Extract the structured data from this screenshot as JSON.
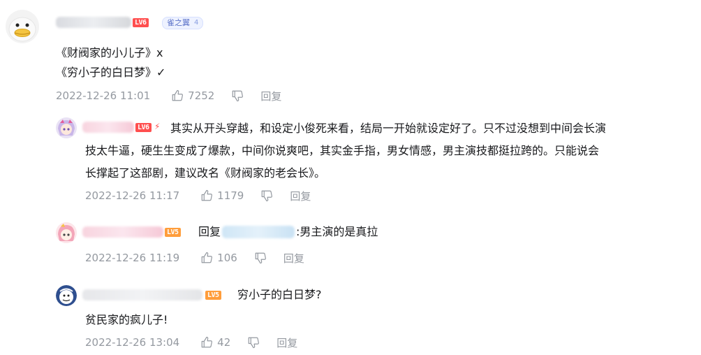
{
  "main_comment": {
    "user_level": "LV6",
    "fan_badge": {
      "label": "雀之翼",
      "level": "4"
    },
    "lines": [
      "《财阀家的小儿子》x",
      "《穷小子的白日梦》✓"
    ],
    "time": "2022-12-26 11:01",
    "likes": "7252",
    "reply_label": "回复"
  },
  "replies": [
    {
      "user_level": "LV6",
      "lines": [
        "其实从开头穿越，和设定小俊死来看，结局一开始就设定好了。只不过没想到中间会长演",
        "技太牛逼，硬生生变成了爆款，中间你说爽吧，其实金手指，男女情感，男主演技都挺拉跨的。只能说会",
        "长撑起了这部剧，建议改名《财阀家的老会长》。"
      ],
      "time": "2022-12-26 11:17",
      "likes": "1179",
      "reply_label": "回复"
    },
    {
      "user_level": "LV5",
      "reply_prefix": "回复",
      "reply_suffix": ":男主演的是真拉",
      "time": "2022-12-26 11:19",
      "likes": "106",
      "reply_label": "回复"
    },
    {
      "user_level": "LV5",
      "lines": [
        "穷小子的白日梦?",
        "贫民家的疯儿子!"
      ],
      "time": "2022-12-26 13:04",
      "likes": "42",
      "reply_label": "回复"
    }
  ],
  "icons": {
    "like": "thumb-up-icon",
    "dislike": "thumb-down-icon"
  },
  "colors": {
    "meta": "#9499a0",
    "lv6": "#ff4f4f",
    "lv5": "#ff9d3b",
    "text": "#18191c"
  }
}
